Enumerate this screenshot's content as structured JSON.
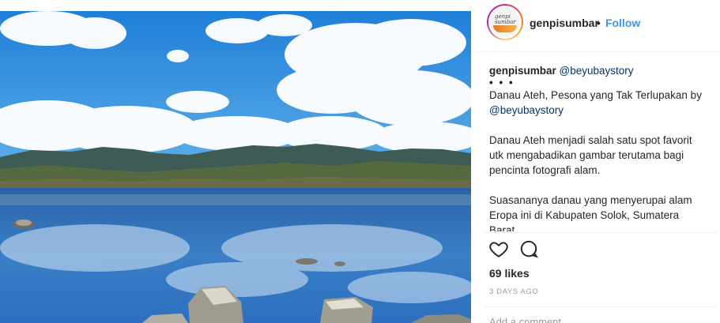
{
  "post": {
    "image_alt": "Danau Ateh lake photo",
    "author": "genpisumbar",
    "dot": "•",
    "follow_label": "Follow",
    "avatar_text": "genpi sumbar",
    "caption": {
      "user": "genpisumbar",
      "mention_top": "@beyubaystory",
      "ellipsis": "• • •",
      "title_prefix": "Danau Ateh, Pesona yang Tak Terlupakan by ",
      "title_mention": "@beyubaystory",
      "para1": "Danau Ateh menjadi salah satu spot favorit utk mengabadikan gambar terutama bagi pencinta fotografi alam.",
      "para2": "Suasananya danau yang menyerupai alam Eropa ini di Kabupaten Solok, Sumatera Barat."
    },
    "icons": {
      "like": "heart-icon",
      "comment": "comment-bubble-icon"
    },
    "likes": "69 likes",
    "timestamp": "3 DAYS AGO",
    "comment_placeholder": "Add a comment..."
  },
  "colors": {
    "link": "#3897f0",
    "mention": "#003569",
    "text": "#262626",
    "muted": "#999999"
  }
}
